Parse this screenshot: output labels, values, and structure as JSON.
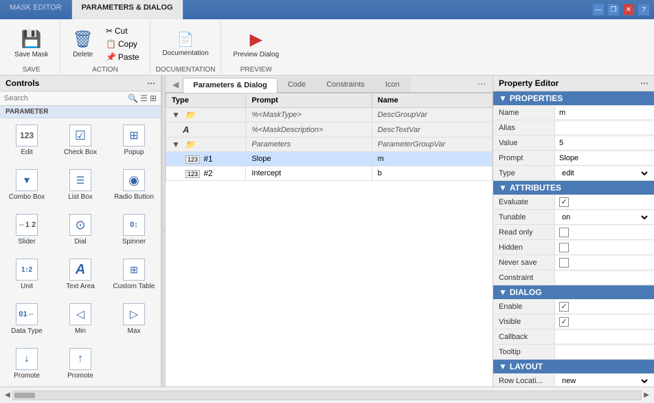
{
  "titleBar": {
    "tabs": [
      {
        "id": "mask-editor",
        "label": "MASK EDITOR",
        "active": false
      },
      {
        "id": "parameters-dialog",
        "label": "PARAMETERS & DIALOG",
        "active": true
      }
    ],
    "controls": [
      "minimize",
      "restore",
      "close",
      "help"
    ]
  },
  "ribbon": {
    "groups": [
      {
        "id": "save",
        "label": "SAVE",
        "buttons": [
          {
            "id": "save-mask",
            "label": "Save Mask",
            "type": "large",
            "icon": "💾"
          }
        ]
      },
      {
        "id": "action",
        "label": "ACTION",
        "buttons": [
          {
            "id": "delete",
            "label": "Delete",
            "type": "large",
            "icon": "🗑"
          },
          {
            "id": "cut",
            "label": "Cut",
            "type": "small",
            "icon": "✂"
          },
          {
            "id": "copy",
            "label": "Copy",
            "type": "small",
            "icon": "📋"
          },
          {
            "id": "paste",
            "label": "Paste",
            "type": "small",
            "icon": "📌"
          }
        ]
      },
      {
        "id": "documentation",
        "label": "DOCUMENTATION",
        "buttons": [
          {
            "id": "documentation",
            "label": "Documentation",
            "type": "large",
            "icon": "📄"
          }
        ]
      },
      {
        "id": "preview",
        "label": "PREVIEW",
        "buttons": [
          {
            "id": "preview-dialog",
            "label": "Preview Dialog",
            "type": "large",
            "icon": "▶"
          }
        ]
      }
    ]
  },
  "leftPanel": {
    "title": "Controls",
    "searchPlaceholder": "Search",
    "paramLabel": "PARAMETER",
    "controls": [
      {
        "id": "edit",
        "label": "Edit",
        "icon": "123"
      },
      {
        "id": "check-box",
        "label": "Check Box",
        "icon": "☑"
      },
      {
        "id": "popup",
        "label": "Popup",
        "icon": "⊞"
      },
      {
        "id": "combo-box",
        "label": "Combo Box",
        "icon": "▾"
      },
      {
        "id": "list-box",
        "label": "List Box",
        "icon": "☰"
      },
      {
        "id": "radio-button",
        "label": "Radio Button",
        "icon": "◉"
      },
      {
        "id": "slider",
        "label": "Slider",
        "icon": "⇔"
      },
      {
        "id": "dial",
        "label": "Dial",
        "icon": "⊙"
      },
      {
        "id": "spinner",
        "label": "Spinner",
        "icon": "↕"
      },
      {
        "id": "unit",
        "label": "Unit",
        "icon": "↕1"
      },
      {
        "id": "text-area",
        "label": "Text Area",
        "icon": "A"
      },
      {
        "id": "custom-table",
        "label": "Custom Table",
        "icon": "⊞"
      },
      {
        "id": "data-type",
        "label": "Data Type",
        "icon": "01"
      },
      {
        "id": "min",
        "label": "Min",
        "icon": "<"
      },
      {
        "id": "max",
        "label": "Max",
        "icon": ">"
      },
      {
        "id": "promote-down",
        "label": "Promote",
        "icon": "⬇"
      },
      {
        "id": "promote-up",
        "label": "Promote",
        "icon": "⬆"
      }
    ]
  },
  "centerPanel": {
    "tabs": [
      {
        "id": "parameters-dialog",
        "label": "Parameters & Dialog",
        "active": true
      },
      {
        "id": "code",
        "label": "Code",
        "active": false
      },
      {
        "id": "constraints",
        "label": "Constraints",
        "active": false
      },
      {
        "id": "icon",
        "label": "Icon",
        "active": false
      }
    ],
    "tableHeaders": [
      "Type",
      "Prompt",
      "Name"
    ],
    "rows": [
      {
        "id": "row1",
        "indent": 1,
        "type": "folder",
        "prompt": "%<MaskType>",
        "name": "DescGroupVar",
        "group": true
      },
      {
        "id": "row2",
        "indent": 1,
        "type": "A",
        "prompt": "%<MaskDescription>",
        "name": "DescTextVar",
        "group": true
      },
      {
        "id": "row3",
        "indent": 1,
        "type": "folder",
        "prompt": "Parameters",
        "name": "ParameterGroupVar",
        "group": true
      },
      {
        "id": "row4",
        "indent": 2,
        "type": "123",
        "number": "#1",
        "prompt": "Slope",
        "name": "m",
        "selected": true
      },
      {
        "id": "row5",
        "indent": 2,
        "type": "123",
        "number": "#2",
        "prompt": "Intercept",
        "name": "b",
        "selected": false
      }
    ]
  },
  "rightPanel": {
    "title": "Property Editor",
    "sections": [
      {
        "id": "properties",
        "label": "PROPERTIES",
        "rows": [
          {
            "label": "Name",
            "value": "m",
            "type": "text"
          },
          {
            "label": "Alias",
            "value": "",
            "type": "text"
          },
          {
            "label": "Value",
            "value": "5",
            "type": "text"
          },
          {
            "label": "Prompt",
            "value": "Slope",
            "type": "text"
          },
          {
            "label": "Type",
            "value": "edit",
            "type": "dropdown"
          }
        ]
      },
      {
        "id": "attributes",
        "label": "ATTRIBUTES",
        "rows": [
          {
            "label": "Evaluate",
            "value": true,
            "type": "checkbox"
          },
          {
            "label": "Tunable",
            "value": "on",
            "type": "dropdown"
          },
          {
            "label": "Read only",
            "value": false,
            "type": "checkbox"
          },
          {
            "label": "Hidden",
            "value": false,
            "type": "checkbox"
          },
          {
            "label": "Never save",
            "value": false,
            "type": "checkbox"
          },
          {
            "label": "Constraint",
            "value": "",
            "type": "text"
          }
        ]
      },
      {
        "id": "dialog",
        "label": "DIALOG",
        "rows": [
          {
            "label": "Enable",
            "value": true,
            "type": "checkbox"
          },
          {
            "label": "Visible",
            "value": true,
            "type": "checkbox"
          },
          {
            "label": "Callback",
            "value": "",
            "type": "text"
          },
          {
            "label": "Tooltip",
            "value": "",
            "type": "text"
          }
        ]
      },
      {
        "id": "layout",
        "label": "LAYOUT",
        "rows": [
          {
            "label": "Row Locati...",
            "value": "new",
            "type": "dropdown"
          }
        ]
      }
    ]
  }
}
